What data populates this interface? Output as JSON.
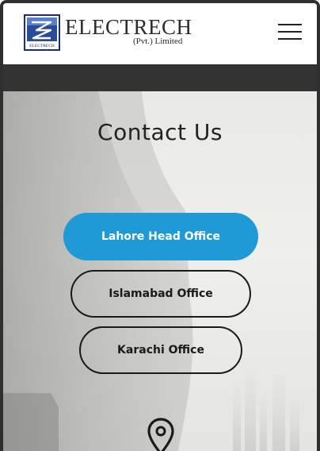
{
  "header": {
    "brand_name": "ELECTRECH",
    "brand_sub": "(Pvt.) Limited",
    "logo_mark_text": "ELECTRECH",
    "menu_icon": "hamburger-menu-icon"
  },
  "main": {
    "title": "Contact Us",
    "offices": [
      {
        "label": "Lahore Head Office",
        "active": true
      },
      {
        "label": "Islamabad Office",
        "active": false
      },
      {
        "label": "Karachi Office",
        "active": false
      }
    ],
    "location_icon": "map-pin-icon"
  },
  "colors": {
    "accent": "#1f9ad6",
    "dark_bar": "#333333",
    "text": "#222222"
  }
}
